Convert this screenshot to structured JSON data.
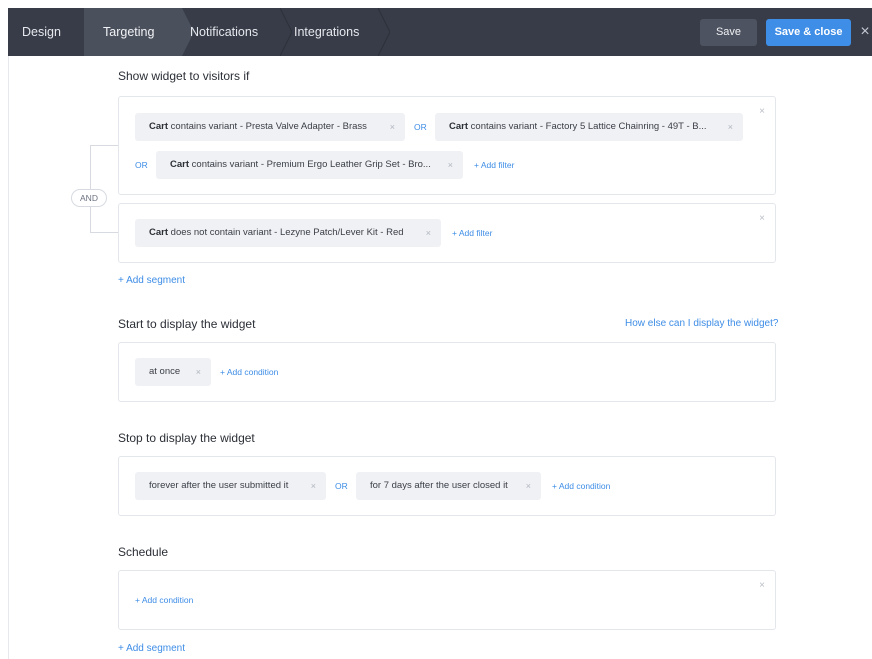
{
  "toolbar": {
    "tabs": [
      "Design",
      "Targeting",
      "Notifications",
      "Integrations"
    ],
    "save_label": "Save",
    "save_close_label": "Save & close"
  },
  "visitors": {
    "title": "Show widget to visitors if",
    "and_label": "AND",
    "segment1": {
      "f1_subject": "Cart",
      "f1_text": "contains variant - Presta Valve Adapter - Brass",
      "or1": "OR",
      "f2_subject": "Cart",
      "f2_text": "contains variant - Factory 5 Lattice Chainring - 49T - B...",
      "or2": "OR",
      "f3_subject": "Cart",
      "f3_text": "contains variant - Premium Ergo Leather Grip Set - Bro...",
      "add_filter": "+ Add filter"
    },
    "segment2": {
      "f1_subject": "Cart",
      "f1_text": "does not contain variant - Lezyne Patch/Lever Kit - Red",
      "add_filter": "+ Add filter"
    },
    "add_segment": "+ Add segment"
  },
  "start": {
    "title": "Start to display the widget",
    "help_link": "How else can I display the widget?",
    "c1": "at once",
    "add_condition": "+ Add condition"
  },
  "stop": {
    "title": "Stop to display the widget",
    "c1": "forever after the user submitted it",
    "or": "OR",
    "c2": "for 7 days after the user closed it",
    "add_condition": "+ Add condition"
  },
  "schedule": {
    "title": "Schedule",
    "add_condition": "+ Add condition",
    "add_segment": "+ Add segment"
  },
  "colors": {
    "topbar": "#373c48",
    "active_tab": "#4a505c",
    "accent": "#3e8de6",
    "chip_bg": "#f0f1f4"
  }
}
